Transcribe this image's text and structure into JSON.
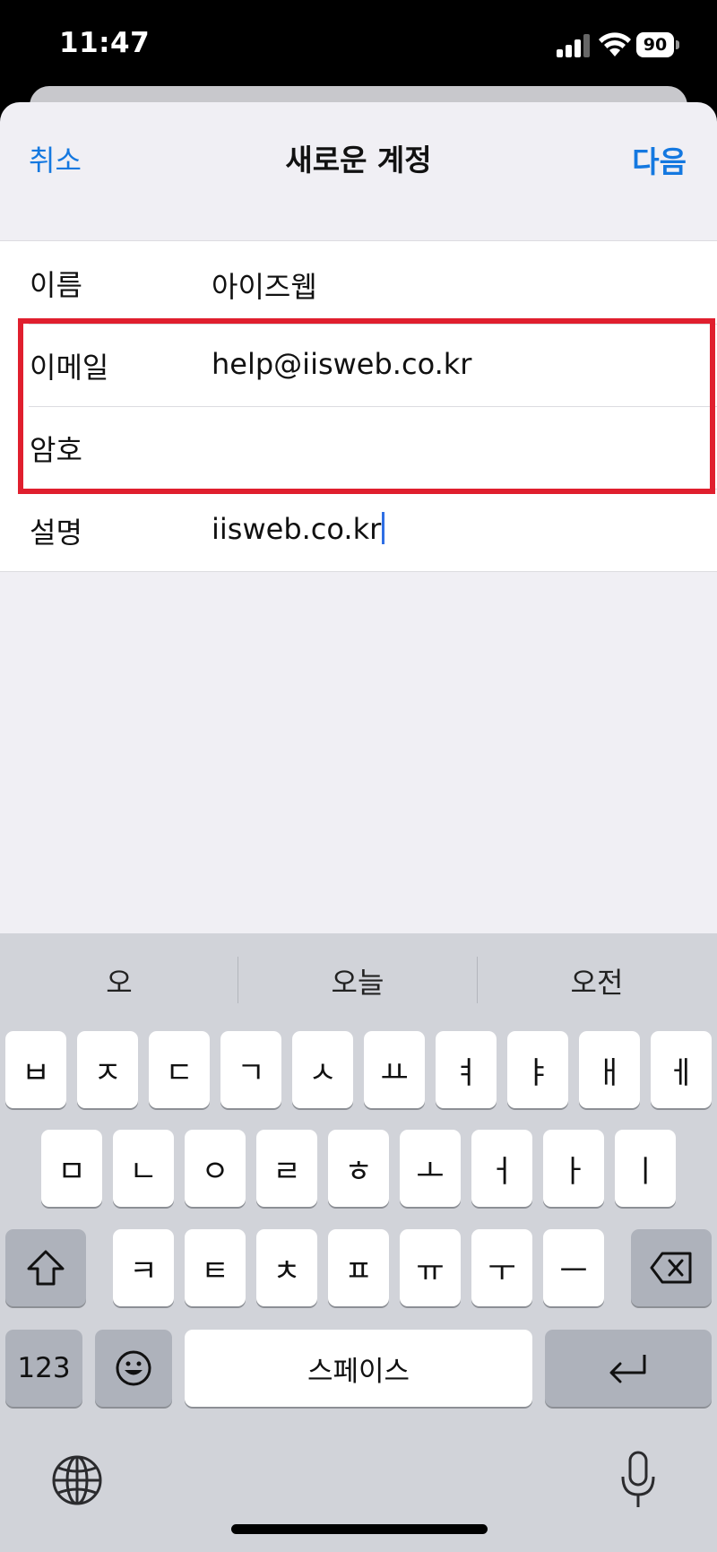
{
  "status_bar": {
    "time": "11:47",
    "battery": "90"
  },
  "nav": {
    "cancel": "취소",
    "title": "새로운 계정",
    "next": "다음"
  },
  "form": {
    "rows": [
      {
        "label": "이름",
        "value": "아이즈웹"
      },
      {
        "label": "이메일",
        "value": "help@iisweb.co.kr"
      },
      {
        "label": "암호",
        "value": ""
      },
      {
        "label": "설명",
        "value": "iisweb.co.kr"
      }
    ]
  },
  "highlight_color": "#e01f2e",
  "accent_color": "#1478e0",
  "keyboard": {
    "suggestions": [
      "오",
      "오늘",
      "오전"
    ],
    "row1": [
      "ㅂ",
      "ㅈ",
      "ㄷ",
      "ㄱ",
      "ㅅ",
      "ㅛ",
      "ㅕ",
      "ㅑ",
      "ㅐ",
      "ㅔ"
    ],
    "row2": [
      "ㅁ",
      "ㄴ",
      "ㅇ",
      "ㄹ",
      "ㅎ",
      "ㅗ",
      "ㅓ",
      "ㅏ",
      "ㅣ"
    ],
    "row3": [
      "ㅋ",
      "ㅌ",
      "ㅊ",
      "ㅍ",
      "ㅠ",
      "ㅜ",
      "ㅡ"
    ],
    "numbers_key": "123",
    "space_key": "스페이스",
    "icons": {
      "shift": "shift-icon",
      "backspace": "backspace-icon",
      "emoji": "emoji-icon",
      "return": "return-icon",
      "globe": "globe-icon",
      "mic": "microphone-icon"
    }
  }
}
